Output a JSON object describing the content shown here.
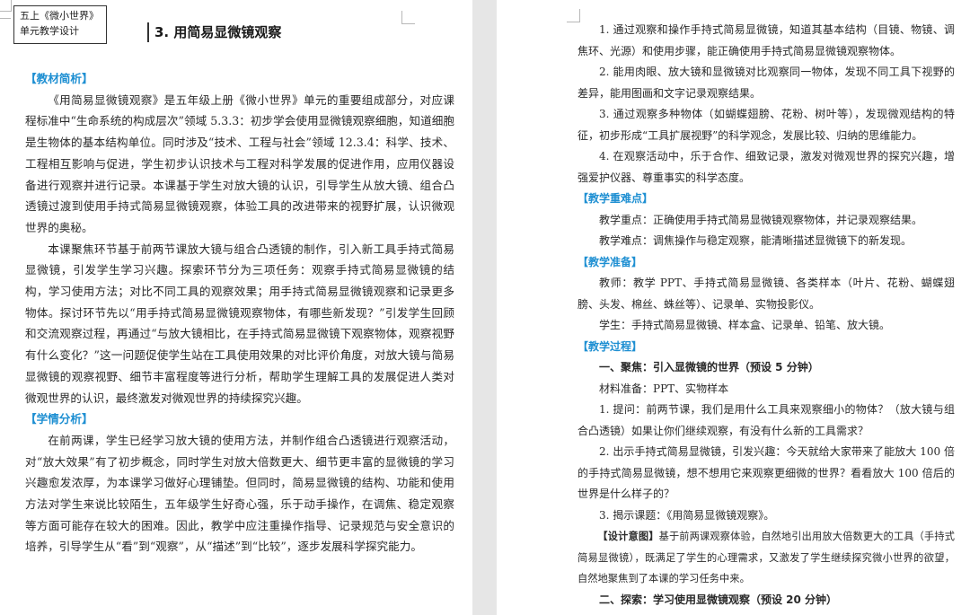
{
  "left_page": {
    "header": {
      "unit_line1": "五上《微小世界》",
      "unit_line2": "单元教学设计",
      "lesson_title": "3. 用简易显微镜观察"
    },
    "sections": [
      {
        "heading": "【教材简析】",
        "paragraphs": [
          "《用简易显微镜观察》是五年级上册《微小世界》单元的重要组成部分，对应课程标准中“生命系统的构成层次”领域 5.3.3：初步学会使用显微镜观察细胞，知道细胞是生物体的基本结构单位。同时涉及“技术、工程与社会”领域 12.3.4：科学、技术、工程相互影响与促进，学生初步认识技术与工程对科学发展的促进作用，应用仪器设备进行观察并进行记录。本课基于学生对放大镜的认识，引导学生从放大镜、组合凸透镜过渡到使用手持式简易显微镜观察，体验工具的改进带来的视野扩展，认识微观世界的奥秘。",
          "本课聚焦环节基于前两节课放大镜与组合凸透镜的制作，引入新工具手持式简易显微镜，引发学生学习兴趣。探索环节分为三项任务：观察手持式简易显微镜的结构，学习使用方法；对比不同工具的观察效果；用手持式简易显微镜观察和记录更多物体。探讨环节先以“用手持式简易显微镜观察物体，有哪些新发现？”引发学生回顾和交流观察过程，再通过“与放大镜相比，在手持式简易显微镜下观察物体，观察视野有什么变化？”这一问题促使学生站在工具使用效果的对比评价角度，对放大镜与简易显微镜的观察视野、细节丰富程度等进行分析，帮助学生理解工具的发展促进人类对微观世界的认识，最终激发对微观世界的持续探究兴趣。"
        ]
      },
      {
        "heading": "【学情分析】",
        "paragraphs": [
          "在前两课，学生已经学习放大镜的使用方法，并制作组合凸透镜进行观察活动，对“放大效果”有了初步概念，同时学生对放大倍数更大、细节更丰富的显微镜的学习兴趣愈发浓厚，为本课学习做好心理铺垫。但同时，简易显微镜的结构、功能和使用方法对学生来说比较陌生，五年级学生好奇心强，乐于动手操作，在调焦、稳定观察等方面可能存在较大的困难。因此，教学中应注重操作指导、记录规范与安全意识的培养，引导学生从“看”到“观察”，从“描述”到“比较”，逐步发展科学探究能力。"
        ]
      }
    ]
  },
  "right_page": {
    "goals": [
      "1. 通过观察和操作手持式简易显微镜，知道其基本结构（目镜、物镜、调焦环、光源）和使用步骤，能正确使用手持式简易显微镜观察物体。",
      "2. 能用肉眼、放大镜和显微镜对比观察同一物体，发现不同工具下视野的差异，能用图画和文字记录观察结果。",
      "3. 通过观察多种物体（如蝴蝶翅膀、花粉、树叶等），发现微观结构的特征，初步形成“工具扩展视野”的科学观念，发展比较、归纳的思维能力。",
      "4. 在观察活动中，乐于合作、细致记录，激发对微观世界的探究兴趣，增强爱护仪器、尊重事实的科学态度。"
    ],
    "key_points_heading": "【教学重难点】",
    "key_points": [
      "教学重点：正确使用手持式简易显微镜观察物体，并记录观察结果。",
      "教学难点：调焦操作与稳定观察，能清晰描述显微镜下的新发现。"
    ],
    "prep_heading": "【教学准备】",
    "prep": [
      "教师：教学 PPT、手持式简易显微镜、各类样本（叶片、花粉、蝴蝶翅膀、头发、棉丝、蛛丝等）、记录单、实物投影仪。",
      "学生：手持式简易显微镜、样本盒、记录单、铅笔、放大镜。"
    ],
    "process_heading": "【教学过程】",
    "process": {
      "step1_title": "一、聚焦：引入显微镜的世界（预设 5 分钟）",
      "materials": "材料准备：PPT、实物样本",
      "items": [
        "1. 提问：前两节课，我们是用什么工具来观察细小的物体？（放大镜与组合凸透镜）如果让你们继续观察，有没有什么新的工具需求？",
        "2. 出示手持式简易显微镜，引发兴趣：今天就给大家带来了能放大 100 倍的手持式简易显微镜，想不想用它来观察更细微的世界？看看放大 100 倍后的世界是什么样子的？",
        "3. 揭示课题：《用简易显微镜观察》。"
      ],
      "design_tag": "【设计意图】",
      "design_text": "基于前两课观察体验，自然地引出用放大倍数更大的工具（手持式简易显微镜），既满足了学生的心理需求，又激发了学生继续探究微小世界的欲望，自然地聚焦到了本课的学习任务中来。",
      "step2_title": "二、探索：学习使用显微镜观察（预设 20 分钟）"
    }
  }
}
